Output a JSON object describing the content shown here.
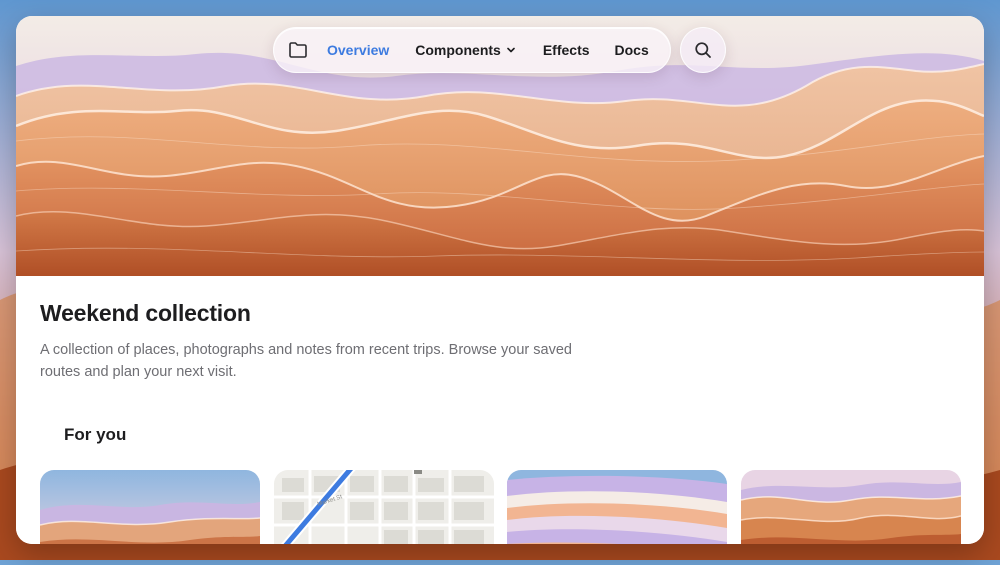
{
  "nav": {
    "items": [
      {
        "label": "Overview",
        "active": true
      },
      {
        "label": "Components",
        "has_dropdown": true
      },
      {
        "label": "Effects"
      },
      {
        "label": "Docs"
      }
    ],
    "leading_icon": "folder-icon",
    "search_icon": "search-icon",
    "active_color": "#3d7be0"
  },
  "page": {
    "title": "Weekend collection",
    "description": "A collection of places, photographs and notes from recent trips. Browse your saved routes and plan your next visit."
  },
  "section": {
    "title": "For you"
  },
  "map_card": {
    "street_label": "Market St"
  },
  "colors": {
    "dune_light": "#e9a878",
    "dune_mid": "#d9834f",
    "dune_dark": "#b9552b",
    "sky_lavender": "#c9b8e6",
    "map_route": "#3d7be0"
  }
}
